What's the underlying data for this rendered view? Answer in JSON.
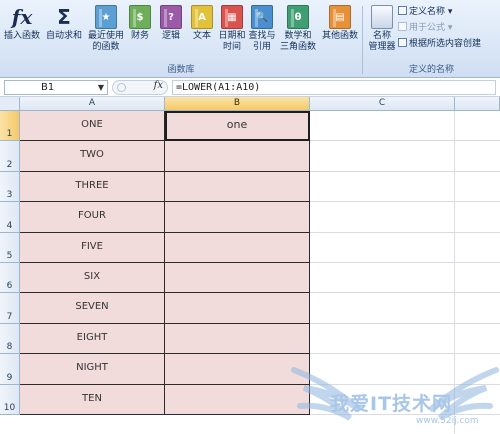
{
  "ribbon": {
    "buttons": [
      {
        "line1": "插入函数",
        "line2": "",
        "icon": "fx-icon",
        "color": "#e9eef6"
      },
      {
        "line1": "自动求和",
        "line2": "",
        "icon": "sigma-icon",
        "color": "#e9eef6"
      },
      {
        "line1": "最近使用",
        "line2": "的函数",
        "icon": "star-book-icon",
        "color": "#5c9fd3"
      },
      {
        "line1": "财务",
        "line2": "",
        "icon": "finance-book-icon",
        "color": "#6fae5a"
      },
      {
        "line1": "逻辑",
        "line2": "",
        "icon": "logic-book-icon",
        "color": "#9a5aa8"
      },
      {
        "line1": "文本",
        "line2": "",
        "icon": "text-book-icon",
        "color": "#e3c23b"
      },
      {
        "line1": "日期和",
        "line2": "时间",
        "icon": "date-book-icon",
        "color": "#d9534f"
      },
      {
        "line1": "查找与",
        "line2": "引用",
        "icon": "lookup-book-icon",
        "color": "#4a8fcf"
      },
      {
        "line1": "数学和",
        "line2": "三角函数",
        "icon": "math-book-icon",
        "color": "#3f9e72"
      },
      {
        "line1": "其他函数",
        "line2": "",
        "icon": "more-book-icon",
        "color": "#e69138"
      },
      {
        "line1": "名称",
        "line2": "管理器",
        "icon": "name-manager-icon",
        "color": "#7c8ea8"
      }
    ],
    "book_glyphs": [
      "★",
      "$",
      "?",
      "A",
      "▦",
      "🔍",
      "θ",
      "▤"
    ],
    "group_label_library": "函数库",
    "group_label_names": "定义的名称",
    "define_name": "定义名称",
    "use_in_formula": "用于公式",
    "create_from_selection": "根据所选内容创建"
  },
  "formula_bar": {
    "name_box": "B1",
    "fx": "fx",
    "formula": "=LOWER(A1:A10)"
  },
  "grid": {
    "columns": [
      "A",
      "B",
      "C"
    ],
    "rows": [
      "1",
      "2",
      "3",
      "4",
      "5",
      "6",
      "7",
      "8",
      "9",
      "10"
    ],
    "col_a": [
      "ONE",
      "TWO",
      "THREE",
      "FOUR",
      "FIVE",
      "SIX",
      "SEVEN",
      "EIGHT",
      "NIGHT",
      "TEN"
    ],
    "col_b": [
      "one",
      "",
      "",
      "",
      "",
      "",
      "",
      "",
      "",
      ""
    ]
  },
  "colors": {
    "cell_fill": "#f2dcdb",
    "header_active": "#f5c96a",
    "ribbon_bg": "#dce8f7"
  },
  "watermark": {
    "text": "我爱IT技术网",
    "url": "www.52ij.com"
  }
}
